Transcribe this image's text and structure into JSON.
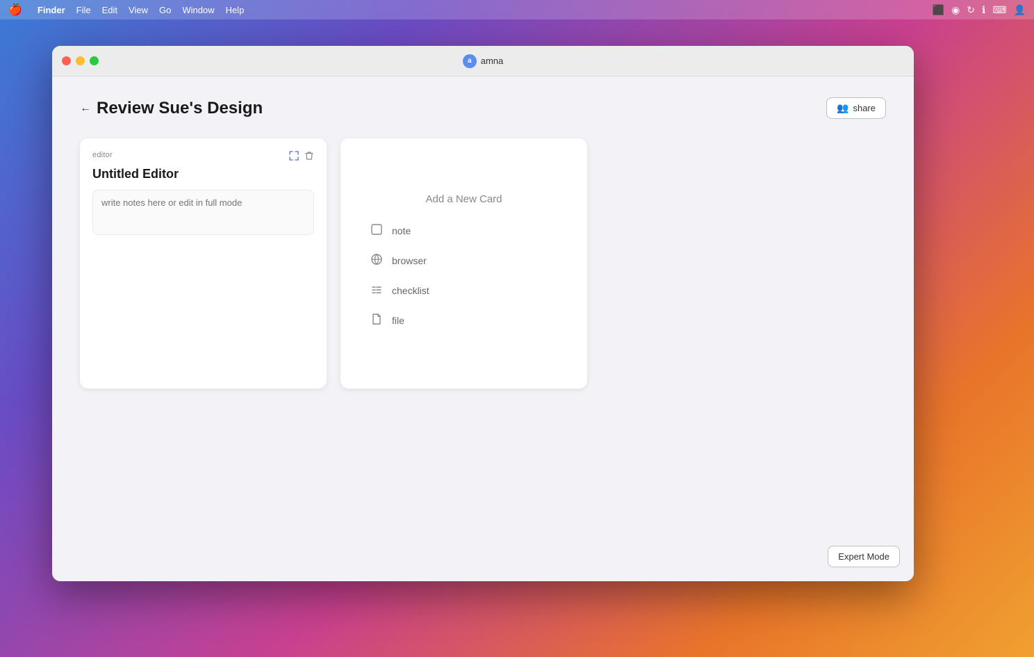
{
  "menubar": {
    "apple": "🍎",
    "items": [
      {
        "label": "Finder",
        "active": true
      },
      {
        "label": "File"
      },
      {
        "label": "Edit"
      },
      {
        "label": "View"
      },
      {
        "label": "Go"
      },
      {
        "label": "Window"
      },
      {
        "label": "Help"
      }
    ],
    "right_icons": [
      "monitor",
      "wifi",
      "sync",
      "info",
      "keyboard",
      "user"
    ]
  },
  "titlebar": {
    "app_name": "amna",
    "avatar_initials": "a"
  },
  "traffic_lights": {
    "close": "close",
    "minimize": "minimize",
    "maximize": "maximize"
  },
  "page": {
    "back_label": "←",
    "title": "Review Sue's Design",
    "share_button": "share"
  },
  "editor_card": {
    "label": "editor",
    "title": "Untitled Editor",
    "notes_placeholder": "write notes here or edit in full mode",
    "expand_icon": "⛶",
    "delete_icon": "🗑"
  },
  "add_card_panel": {
    "title": "Add a New Card",
    "types": [
      {
        "icon": "note",
        "label": "note"
      },
      {
        "icon": "browser",
        "label": "browser"
      },
      {
        "icon": "checklist",
        "label": "checklist"
      },
      {
        "icon": "file",
        "label": "file"
      }
    ]
  },
  "expert_mode_button": "Expert Mode"
}
